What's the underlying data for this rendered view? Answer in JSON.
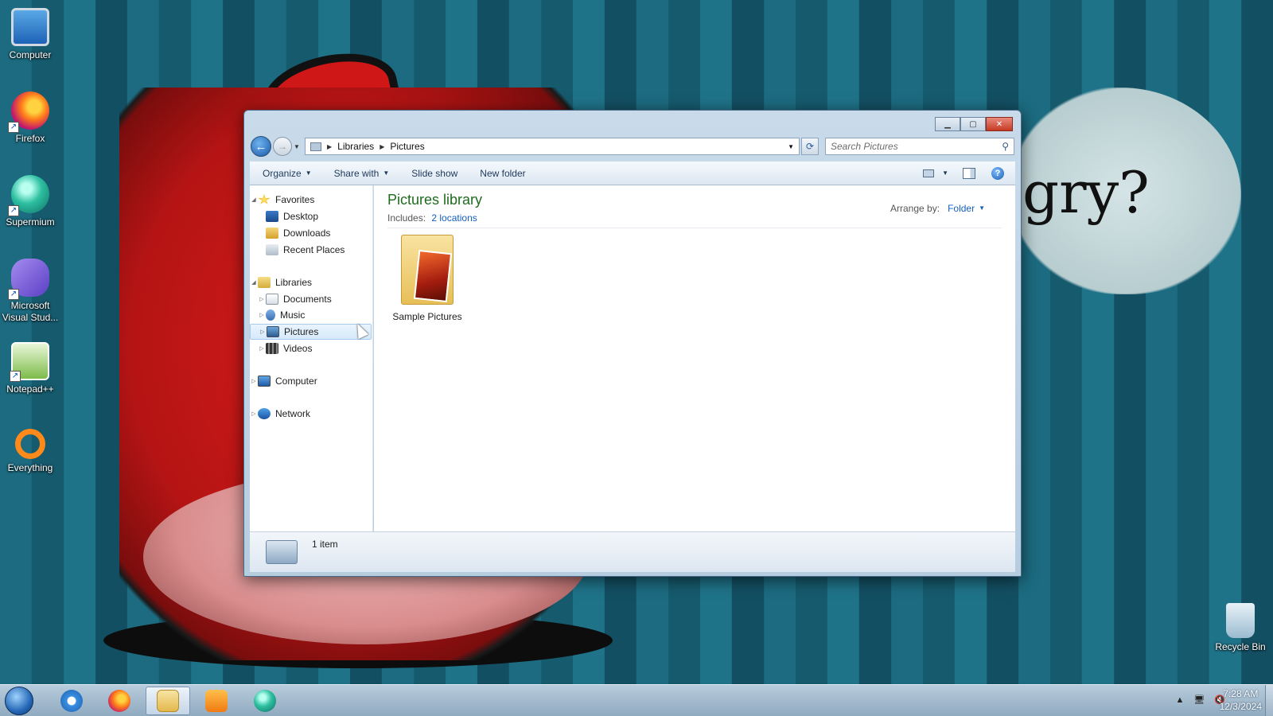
{
  "wallpaper": {
    "caption": "gry?"
  },
  "desktop": {
    "icons": [
      {
        "label": "Computer",
        "icon": "computer-icon"
      },
      {
        "label": "Firefox",
        "icon": "firefox-icon"
      },
      {
        "label": "Supermium",
        "icon": "supermium-icon"
      },
      {
        "label": "Microsoft Visual Stud...",
        "icon": "visual-studio-icon"
      },
      {
        "label": "Notepad++",
        "icon": "notepad-plus-plus-icon"
      },
      {
        "label": "Everything",
        "icon": "everything-icon"
      },
      {
        "label": "Recycle Bin",
        "icon": "recycle-bin-icon"
      }
    ]
  },
  "window": {
    "address": {
      "crumbs": [
        "Libraries",
        "Pictures"
      ]
    },
    "search": {
      "placeholder": "Search Pictures"
    },
    "toolbar": {
      "organize": "Organize",
      "share_with": "Share with",
      "slide_show": "Slide show",
      "new_folder": "New folder"
    },
    "nav": {
      "favorites": "Favorites",
      "desktop": "Desktop",
      "downloads": "Downloads",
      "recent_places": "Recent Places",
      "libraries": "Libraries",
      "documents": "Documents",
      "music": "Music",
      "pictures": "Pictures",
      "videos": "Videos",
      "computer": "Computer",
      "network": "Network"
    },
    "content": {
      "title": "Pictures library",
      "includes_label": "Includes:",
      "includes_link": "2 locations",
      "arrange_label": "Arrange by:",
      "arrange_value": "Folder",
      "items": [
        {
          "name": "Sample Pictures"
        }
      ]
    },
    "status": {
      "count": "1 item"
    }
  },
  "taskbar": {
    "apps": [
      "internet-explorer",
      "firefox",
      "windows-explorer",
      "media-player",
      "supermium"
    ],
    "active_app": "windows-explorer",
    "clock": {
      "time": "7:28 AM",
      "date": "12/3/2024"
    }
  }
}
